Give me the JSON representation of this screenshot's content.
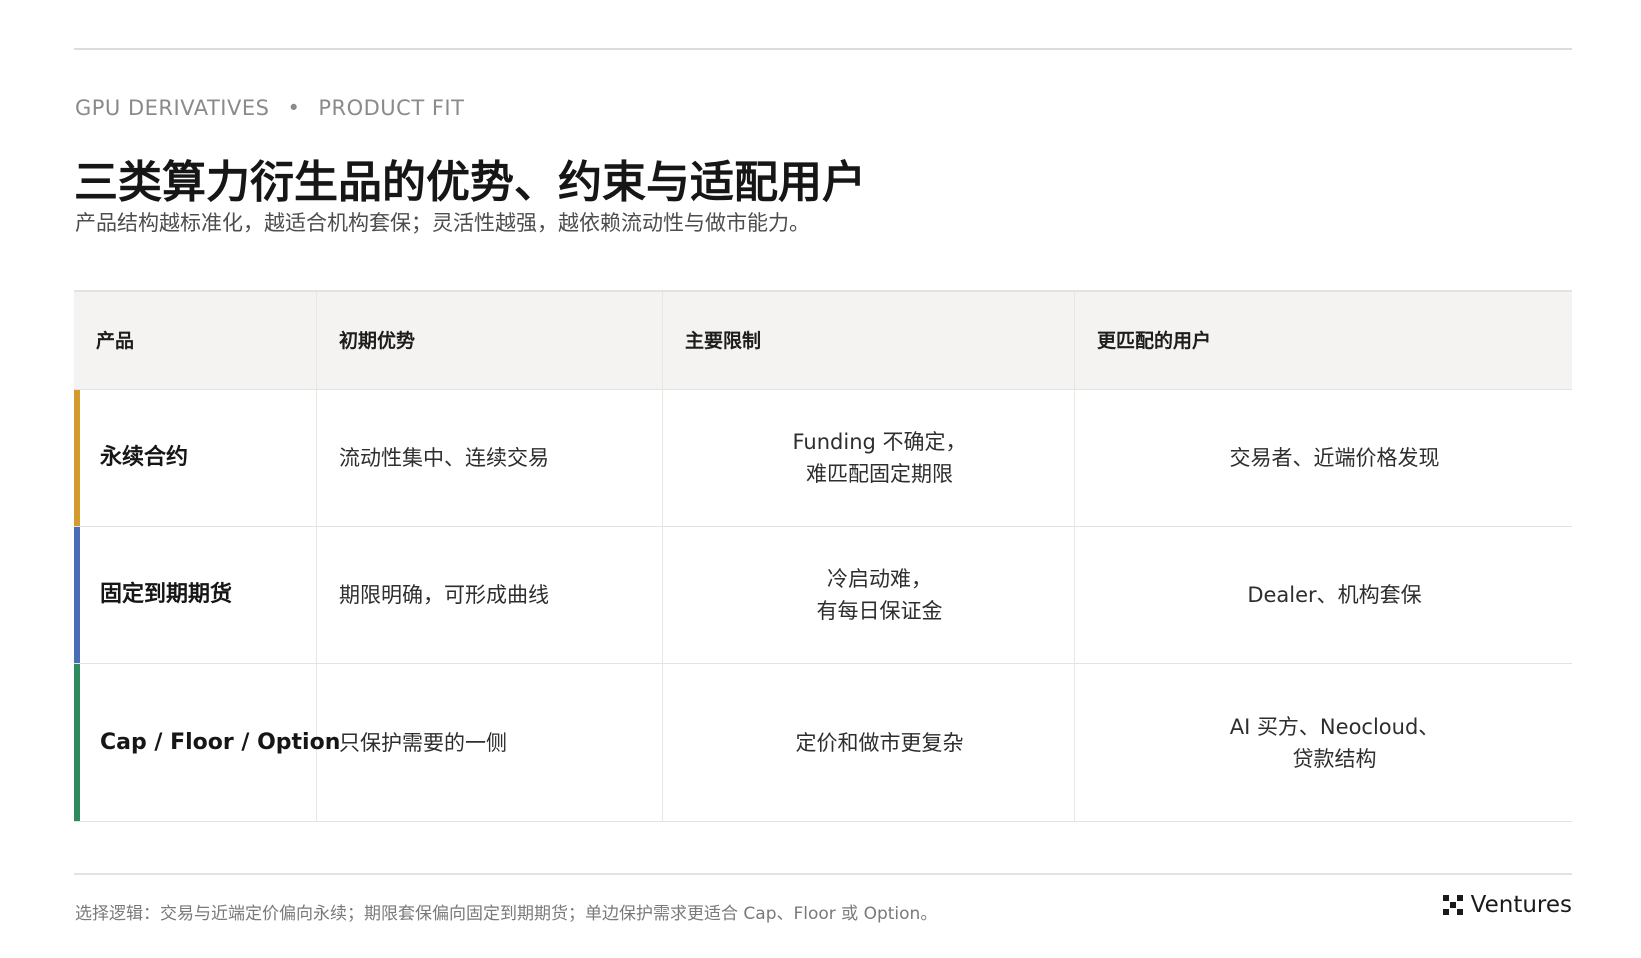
{
  "header": {
    "eyebrow_left": "GPU DERIVATIVES",
    "eyebrow_sep": "•",
    "eyebrow_right": "PRODUCT FIT",
    "title": "三类算力衍生品的优势、约束与适配用户",
    "subtitle": "产品结构越标准化，越适合机构套保；灵活性越强，越依赖流动性与做市能力。"
  },
  "table": {
    "columns": [
      "产品",
      "初期优势",
      "主要限制",
      "更匹配的用户"
    ],
    "rows": [
      {
        "product": "永续合约",
        "accent_color": "#d39a2c",
        "advantage": "流动性集中、连续交易",
        "limit_lines": [
          "Funding 不确定，",
          "难匹配固定期限"
        ],
        "user_lines": [
          "交易者、近端价格发现"
        ]
      },
      {
        "product": "固定到期期货",
        "accent_color": "#4a6eb5",
        "advantage": "期限明确，可形成曲线",
        "limit_lines": [
          "冷启动难，",
          "有每日保证金"
        ],
        "user_lines": [
          "Dealer、机构套保"
        ]
      },
      {
        "product": "Cap / Floor / Option",
        "accent_color": "#2f8a5e",
        "advantage": "只保护需要的一侧",
        "limit_lines": [
          "定价和做市更复杂"
        ],
        "user_lines": [
          "AI 买方、Neocloud、",
          "贷款结构"
        ]
      }
    ]
  },
  "footer": {
    "note": "选择逻辑：交易与近端定价偏向永续；期限套保偏向固定到期期货；单边保护需求更适合 Cap、Floor 或 Option。",
    "brand": "Ventures",
    "brand_icon": "x-logo-icon"
  }
}
